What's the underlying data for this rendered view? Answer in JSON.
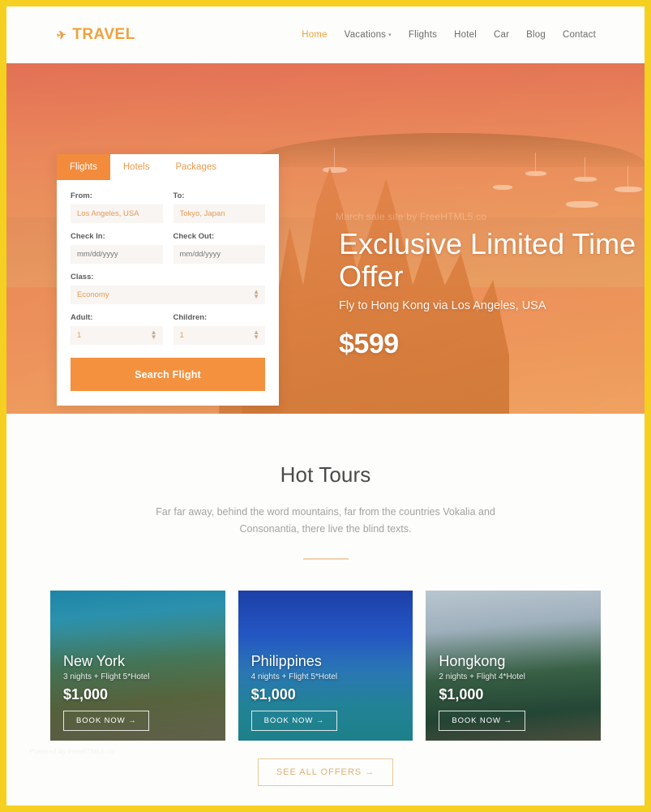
{
  "header": {
    "logo_icon": "airplane-icon",
    "logo_text": "TRAVEL",
    "nav": [
      {
        "label": "Home",
        "active": true,
        "has_dropdown": false
      },
      {
        "label": "Vacations",
        "active": false,
        "has_dropdown": true
      },
      {
        "label": "Flights",
        "active": false,
        "has_dropdown": false
      },
      {
        "label": "Hotel",
        "active": false,
        "has_dropdown": false
      },
      {
        "label": "Car",
        "active": false,
        "has_dropdown": false
      },
      {
        "label": "Blog",
        "active": false,
        "has_dropdown": false
      },
      {
        "label": "Contact",
        "active": false,
        "has_dropdown": false
      }
    ]
  },
  "hero": {
    "watermark": "March sale site by FreeHTML5.co",
    "title": "Exclusive Limited Time Offer",
    "subtitle": "Fly to Hong Kong via Los Angeles, USA",
    "price": "$599"
  },
  "booking": {
    "tabs": [
      {
        "label": "Flights",
        "active": true
      },
      {
        "label": "Hotels",
        "active": false
      },
      {
        "label": "Packages",
        "active": false
      }
    ],
    "fields": {
      "from_label": "From:",
      "from_value": "Los Angeles, USA",
      "to_label": "To:",
      "to_value": "Tokyo, Japan",
      "checkin_label": "Check In:",
      "checkin_placeholder": "mm/dd/yyyy",
      "checkout_label": "Check Out:",
      "checkout_placeholder": "mm/dd/yyyy",
      "class_label": "Class:",
      "class_value": "Economy",
      "adult_label": "Adult:",
      "adult_value": "1",
      "children_label": "Children:",
      "children_value": "1"
    },
    "search_button": "Search Flight"
  },
  "tours": {
    "title": "Hot Tours",
    "description": "Far far away, behind the word mountains, far from the countries Vokalia and Consonantia, there live the blind texts.",
    "cards": [
      {
        "title": "New York",
        "meta": "3 nights + Flight 5*Hotel",
        "price": "$1,000",
        "button": "BOOK NOW",
        "arrow": "→"
      },
      {
        "title": "Philippines",
        "meta": "4 nights + Flight 5*Hotel",
        "price": "$1,000",
        "button": "BOOK NOW",
        "arrow": "→"
      },
      {
        "title": "Hongkong",
        "meta": "2 nights + Flight 4*Hotel",
        "price": "$1,000",
        "button": "BOOK NOW",
        "arrow": "→"
      }
    ],
    "see_all_label": "SEE ALL OFFERS",
    "see_all_arrow": "→"
  },
  "footer": {
    "watermark": "Powered by FreeHTML5.co"
  },
  "colors": {
    "accent": "#f3913f",
    "logo": "#f0a13c",
    "nav_active": "#f0a23e",
    "frame": "#f5d020",
    "divider": "#efd2ad",
    "outline_button": "#e8c79b"
  }
}
